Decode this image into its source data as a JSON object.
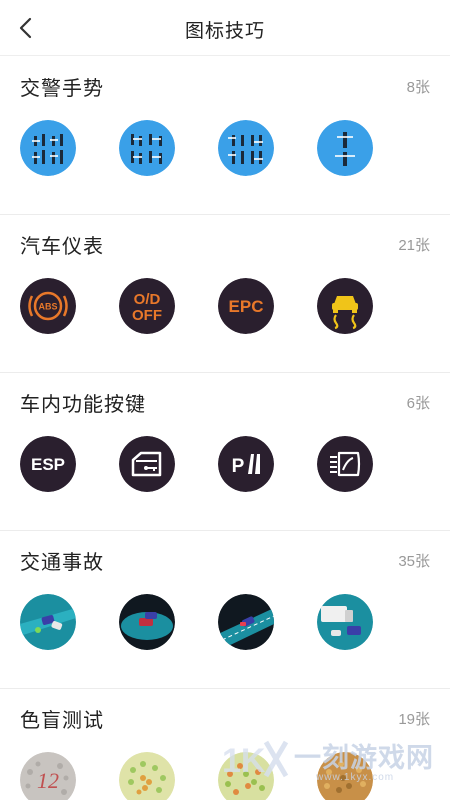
{
  "header": {
    "title": "图标技巧",
    "back_icon": "chevron-left-icon"
  },
  "sections": [
    {
      "title": "交警手势",
      "count": "8张",
      "icons": [
        "traffic-police-gesture-1",
        "traffic-police-gesture-2",
        "traffic-police-gesture-3",
        "traffic-police-gesture-4"
      ]
    },
    {
      "title": "汽车仪表",
      "count": "21张",
      "icons": [
        "abs-warning-icon",
        "od-off-icon",
        "epc-icon",
        "traction-control-icon"
      ],
      "icon_text": {
        "abs": "ABS",
        "od1": "O/D",
        "od2": "OFF",
        "epc": "EPC"
      }
    },
    {
      "title": "车内功能按键",
      "count": "6张",
      "icons": [
        "esp-icon",
        "door-unlock-icon",
        "parking-sensor-icon",
        "rear-defrost-icon"
      ],
      "icon_text": {
        "esp": "ESP"
      }
    },
    {
      "title": "交通事故",
      "count": "35张",
      "icons": [
        "accident-scene-1",
        "accident-scene-2",
        "accident-scene-3",
        "accident-scene-4"
      ]
    },
    {
      "title": "色盲测试",
      "count": "19张",
      "icons": [
        "color-blind-plate-1",
        "color-blind-plate-2",
        "color-blind-plate-3",
        "color-blind-plate-4"
      ],
      "icon_text": {
        "plate1": "12"
      }
    }
  ],
  "watermark": {
    "text": "一刻游戏网",
    "url": "www.1kyx.com",
    "logo": "1KYX"
  },
  "colors": {
    "police_blue": "#3aa0e8",
    "dash_bg": "#2a1f2e",
    "dash_orange": "#e8782a",
    "dash_yellow": "#f0c419",
    "key_bg": "#2a1f2e",
    "accident_teal": "#1b8fa0"
  }
}
